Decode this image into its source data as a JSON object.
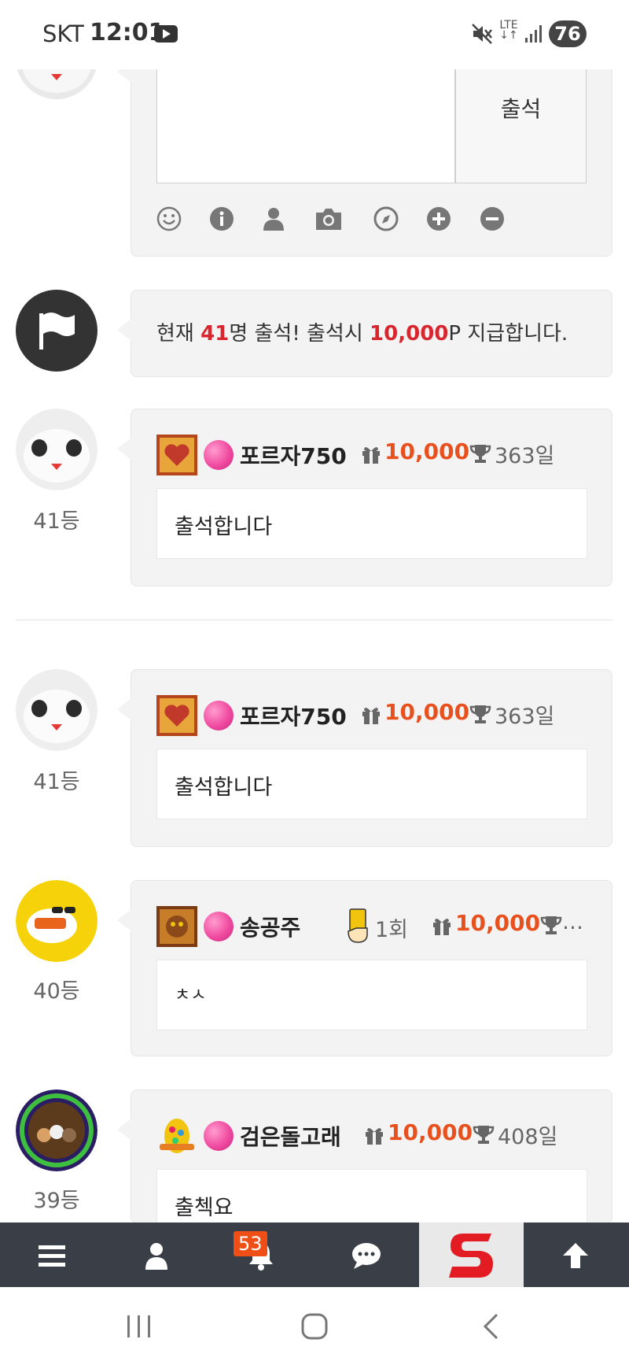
{
  "status_bar": {
    "carrier": "SKT",
    "time": "12:01",
    "network": "LTE",
    "battery": "76"
  },
  "composer": {
    "attend_button": "출석",
    "toolbar": [
      "smile-icon",
      "info-icon",
      "user-icon",
      "camera-icon",
      "compass-icon",
      "plus-circle-icon",
      "minus-circle-icon"
    ]
  },
  "notice": {
    "prefix": "현재 ",
    "count": "41",
    "middle": "명 출석! 출석시 ",
    "points": "10,000",
    "suffix": "P 지급합니다."
  },
  "entries": [
    {
      "rank": "41등",
      "nickname": "포르자750",
      "points": "10,000",
      "days": "363일",
      "message": "출석합니다"
    },
    {
      "rank": "41등",
      "nickname": "포르자750",
      "points": "10,000",
      "days": "363일",
      "message": "출석합니다"
    },
    {
      "rank": "40등",
      "nickname": "송공주",
      "card_count": "1회",
      "points": "10,000",
      "days": "…",
      "message": "ㅊㅅ"
    },
    {
      "rank": "39등",
      "nickname": "검은돌고래",
      "points": "10,000",
      "days": "408일",
      "message": "출첵요"
    }
  ],
  "bottom_nav": {
    "notification_count": "53",
    "items": [
      "menu-icon",
      "user-icon",
      "bell-icon",
      "chat-icon",
      "site-logo",
      "arrow-up-icon"
    ]
  },
  "colors": {
    "accent_red": "#d8252e",
    "points_orange": "#e8501d",
    "nav_bg": "#3a3f47"
  }
}
